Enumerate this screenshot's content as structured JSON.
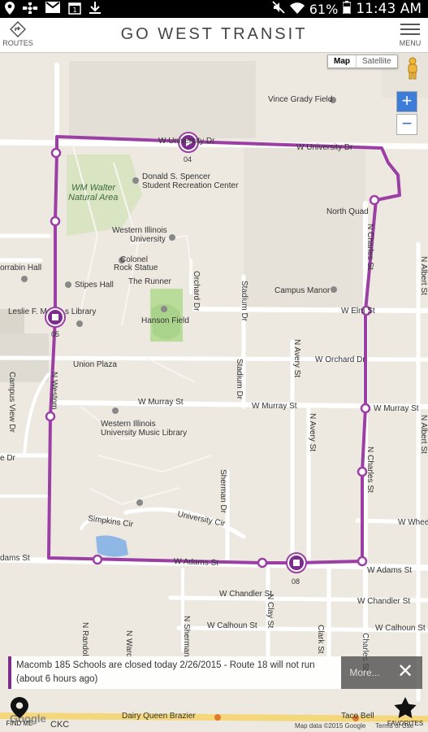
{
  "status_bar": {
    "battery": "61%",
    "time": "11:43 AM"
  },
  "header": {
    "title": "GO WEST TRANSIT",
    "routes_label": "ROUTES",
    "menu_label": "MENU"
  },
  "map_controls": {
    "map_label": "Map",
    "satellite_label": "Satellite",
    "zoom_in": "+",
    "zoom_out": "−"
  },
  "map_labels": {
    "vince_grady": "Vince Grady Field",
    "w_university_dr": "W University Dr",
    "w_university_dr_top": "W University Dr",
    "spencer_1": "Donald S. Spencer",
    "spencer_2": "Student Recreation Center",
    "wm_walter_1": "WM Walter",
    "wm_walter_2": "Natural Area",
    "north_quad": "North Quad",
    "wiu_1": "Western Illinois",
    "wiu_2": "University",
    "colonel_1": "Colonel",
    "colonel_2": "Rock Statue",
    "the_runner": "The Runner",
    "orrabin_hall": "orrabin Hall",
    "stipes_hall": "Stipes Hall",
    "campus_manor": "Campus Manor",
    "leslie_library": "Leslie F. M",
    "library_suffix": "s Library",
    "hanson_field": "Hanson Field",
    "w_elm_st": "W Elm St",
    "w_orchard_dr": "W Orchard Dr",
    "union_plaza": "Union Plaza",
    "w_murray_st": "W Murray St",
    "w_murray_st_right": "W Murray St",
    "music_library_1": "Western Illinois",
    "music_library_2": "University Music Library",
    "university_cir": "University Cir",
    "simpkins_cir": "Simpkins Cir",
    "w_adams_st": "W Adams St",
    "w_adams_st_right": "W Adams St",
    "adams_st_left": "dams St",
    "w_chandler_st": "W Chandler St",
    "w_chandler_st_right": "W Chandler St",
    "w_calhoun_st": "W Calhoun St",
    "w_calhoun_st_right": "W Calhoun St",
    "w_wheel": "W Whee",
    "campus_view_dr": "Campus View Dr",
    "n_westom": "N Westom",
    "orchard_dr": "Orchard Dr",
    "stadium_dr": "Stadium Dr",
    "stadium_dr_2": "Stadium Dr",
    "n_avery_st": "N Avery St",
    "n_avery_st_2": "N Avery St",
    "n_charles_st": "N Charles St",
    "n_charles_st_2": "N Charles St",
    "n_charles_st_3": "Charles St",
    "sherman_dr": "Sherman Dr",
    "n_sherman": "N Sherman",
    "n_clay_st": "N Clay St",
    "clark_st": "Clark St",
    "n_ward_st": "N Ward S",
    "n_randolph": "N Randol",
    "n_albert_st": "N Albert St",
    "n_albert_st_2": "N Albert St",
    "e_dr": "e Dr",
    "n_w_dr": "n Dr",
    "dairy_queen": "Dairy Queen Brazier",
    "taco_bell": "Taco Bell",
    "ckc": "CKC",
    "stop_04": "04",
    "stop_05": "05",
    "stop_08": "08"
  },
  "alert": {
    "message": "Macomb 185 Schools are closed today 2/26/2015 - Route 18 will not run (about 6 hours ago)",
    "more_label": "More...",
    "close_label": "✕"
  },
  "bottom": {
    "find_me_label": "FIND ME",
    "favorites_label": "FAVORITES",
    "google_label": "Google",
    "map_data_label": "Map data ©2015 Google",
    "terms_label": "Terms of Use"
  },
  "colors": {
    "route": "#9b3fa5",
    "stop_fill": "#7b2c8c",
    "map_bg": "#ede9e1",
    "road": "#ffffff",
    "park": "#c8dfa8"
  }
}
